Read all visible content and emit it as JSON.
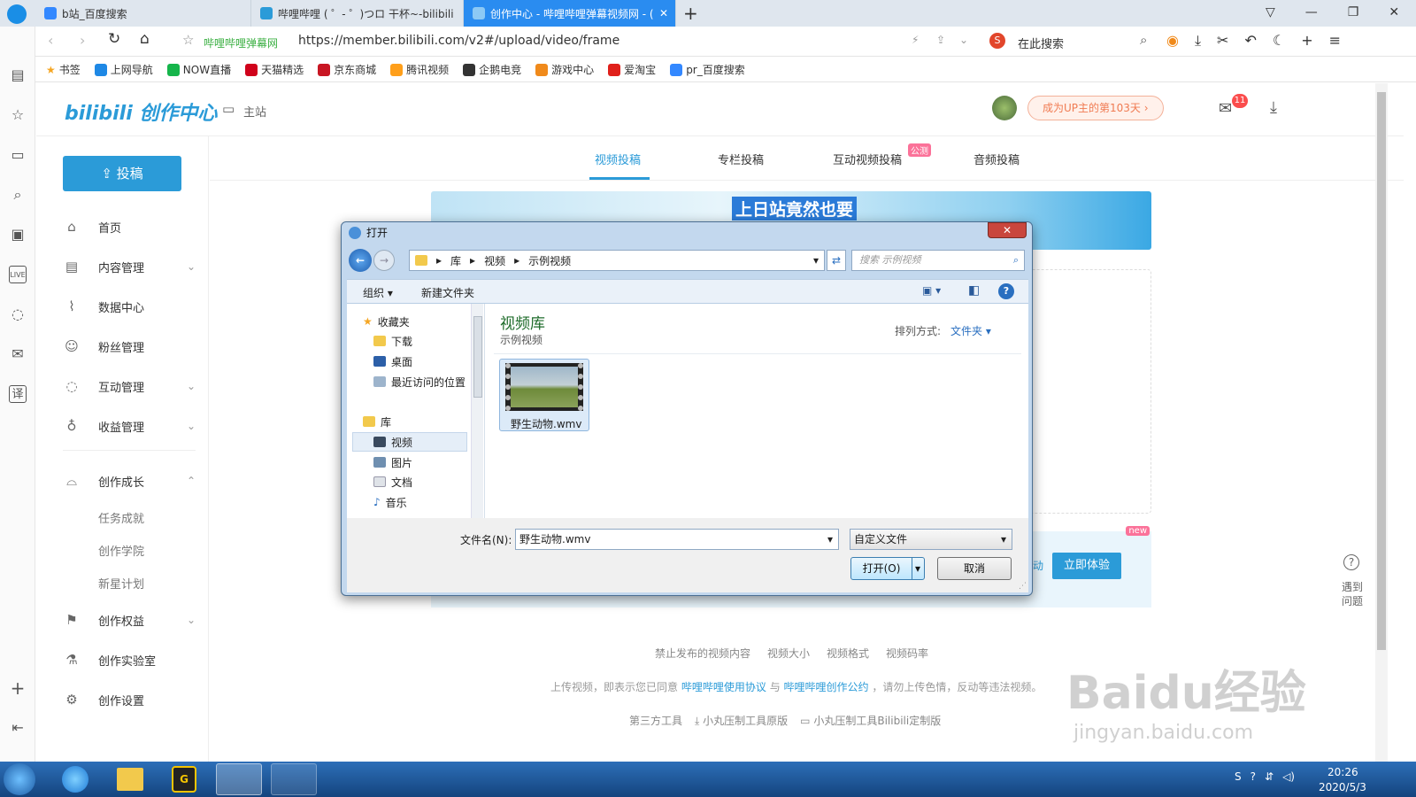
{
  "browser": {
    "tabs": [
      {
        "label": "b站_百度搜索"
      },
      {
        "label": "哔哩哔哩 ( ゜- ゜)つロ 干杯~-bilibili"
      },
      {
        "label": "创作中心 - 哔哩哔哩弹幕视频网 - ("
      }
    ],
    "site_label": "哔哩哔哩弹幕网",
    "url": "https://member.bilibili.com/v2#/upload/video/frame",
    "search_placeholder": "在此搜索",
    "bookmarks": [
      "书签",
      "上网导航",
      "NOW直播",
      "天猫精选",
      "京东商城",
      "腾讯视频",
      "企鹅电竞",
      "游戏中心",
      "爱淘宝",
      "pr_百度搜索"
    ]
  },
  "header": {
    "logo": "bilibili 创作中心",
    "main_site": "主站",
    "up_badge": "成为UP主的第103天",
    "mail_count": "11"
  },
  "sidebar": {
    "upload_button": "投稿",
    "items": [
      {
        "label": "首页"
      },
      {
        "label": "内容管理"
      },
      {
        "label": "数据中心"
      },
      {
        "label": "粉丝管理"
      },
      {
        "label": "互动管理"
      },
      {
        "label": "收益管理"
      },
      {
        "label": "创作成长"
      },
      {
        "label": "创作权益"
      },
      {
        "label": "创作实验室"
      },
      {
        "label": "创作设置"
      }
    ],
    "growth_sub": [
      "任务成就",
      "创作学院",
      "新星计划"
    ]
  },
  "upload_tabs": [
    "视频投稿",
    "专栏投稿",
    "互动视频投稿",
    "音频投稿"
  ],
  "upload_tab_badge": "公测",
  "banner_text": "上日站竟然也要",
  "promo": {
    "new_badge": "new",
    "fragment": "动",
    "button": "立即体验"
  },
  "help": {
    "line1": "遇到",
    "line2": "问题"
  },
  "footer": {
    "links": [
      "禁止发布的视频内容",
      "视频大小",
      "视频格式",
      "视频码率"
    ],
    "notice_prefix": "上传视频，即表示您已同意",
    "notice_link1": "哔哩哔哩使用协议",
    "notice_mid": "与",
    "notice_link2": "哔哩哔哩创作公约",
    "notice_suffix": "，请勿上传色情，反动等违法视频。",
    "tools_label": "第三方工具",
    "tool1": "小丸压制工具原版",
    "tool2": "小丸压制工具Bilibili定制版"
  },
  "dialog": {
    "title": "打开",
    "breadcrumb": [
      "库",
      "视频",
      "示例视频"
    ],
    "search_placeholder": "搜索 示例视频",
    "toolbar": {
      "organize": "组织",
      "new_folder": "新建文件夹"
    },
    "nav": {
      "favorites": "收藏夹",
      "favorites_items": [
        "下载",
        "桌面",
        "最近访问的位置"
      ],
      "libraries": "库",
      "library_items": [
        "视频",
        "图片",
        "文档",
        "音乐"
      ]
    },
    "library_title": "视频库",
    "library_subtitle": "示例视频",
    "sort_label": "排列方式:",
    "sort_value": "文件夹",
    "file_name": "野生动物.wmv",
    "filename_label": "文件名(N):",
    "filename_value": "野生动物.wmv",
    "filetype": "自定义文件",
    "open_button": "打开(O)",
    "cancel_button": "取消"
  },
  "taskbar": {
    "time": "20:26",
    "date": "2020/5/3"
  },
  "watermark": {
    "main": "Baidu经验",
    "sub": "jingyan.baidu.com"
  },
  "colors": {
    "accent": "#2b9bd8",
    "tab_active": "#2a8cf0",
    "pink": "#fb7299",
    "taskbar": "#1c5a9e"
  }
}
